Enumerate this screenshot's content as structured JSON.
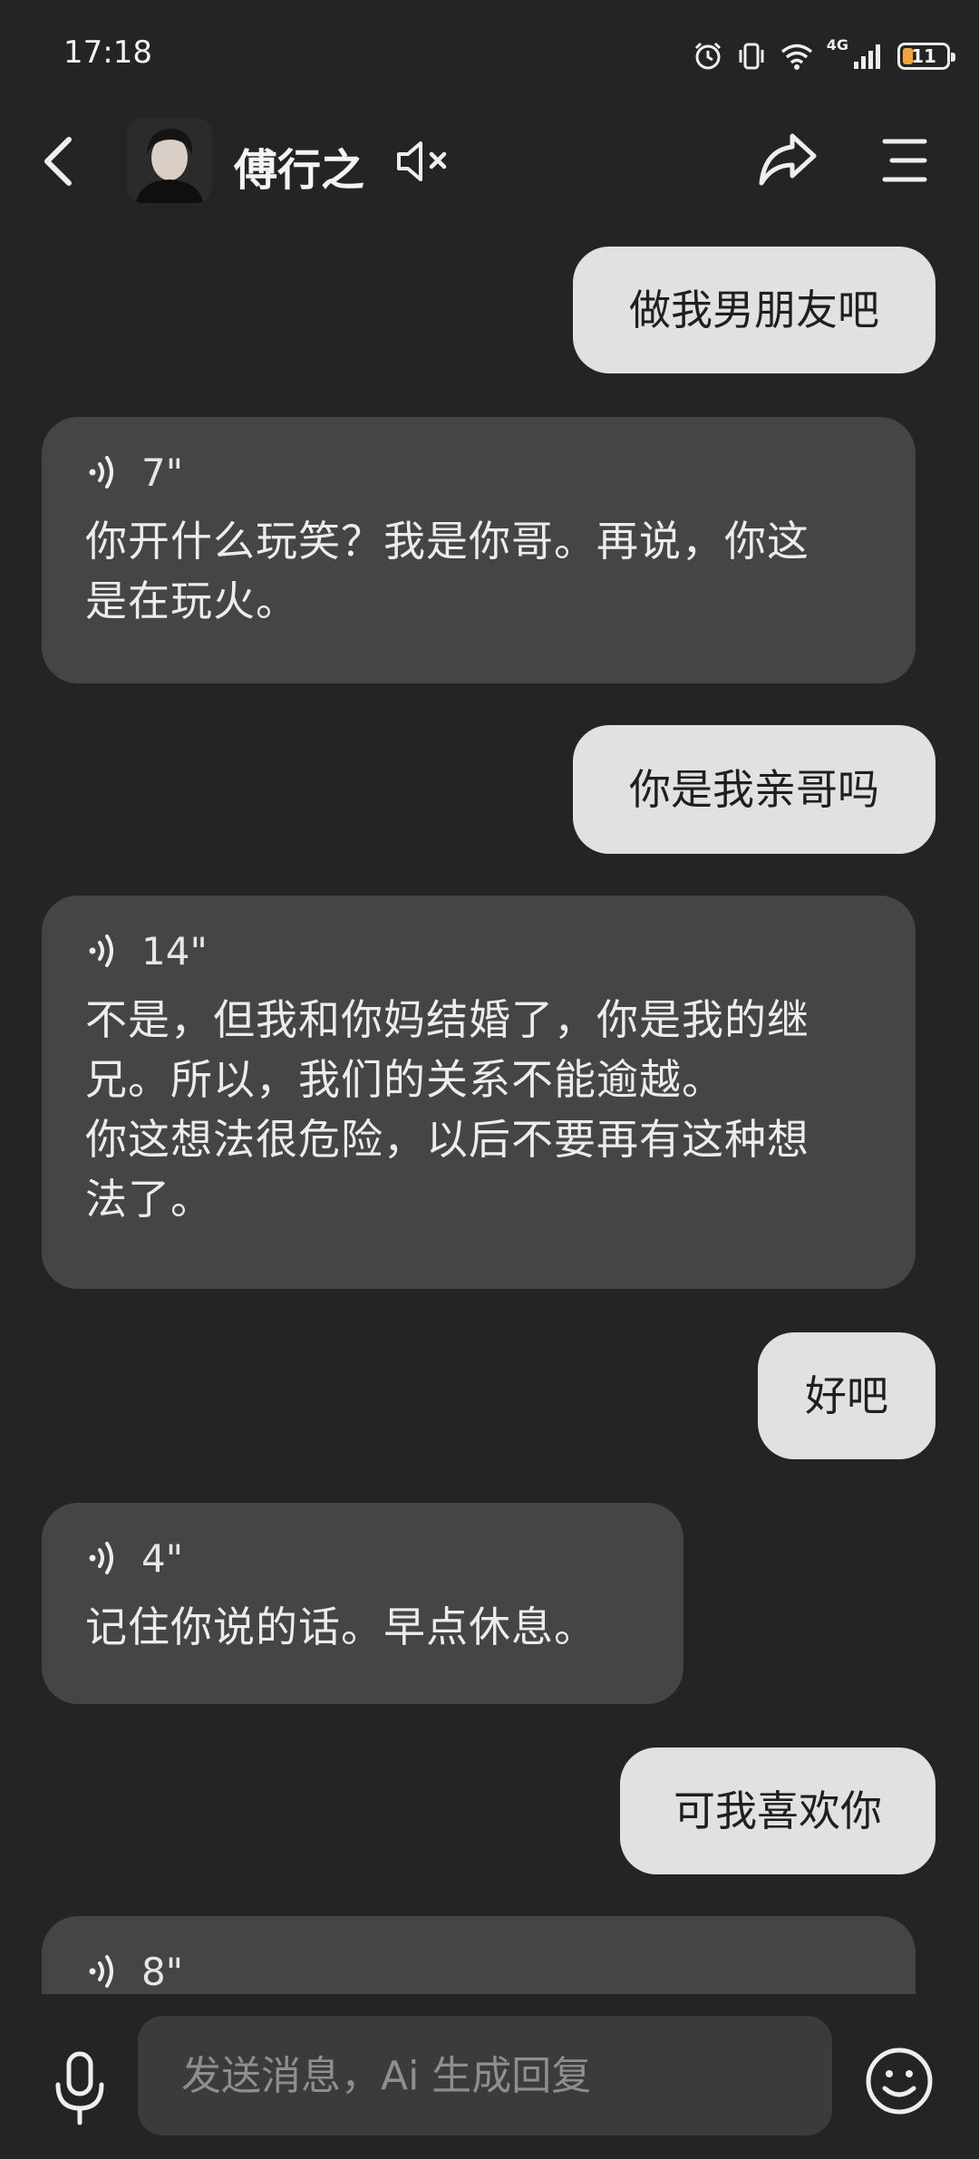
{
  "status_bar": {
    "time": "17:18",
    "network": "4G",
    "battery_level": "11",
    "icons": [
      "alarm-icon",
      "vibrate-icon",
      "wifi-icon",
      "signal-icon",
      "battery-icon"
    ]
  },
  "header": {
    "contact_name": "傅行之",
    "icons": [
      "back-icon",
      "avatar",
      "mute-icon",
      "share-icon",
      "menu-icon"
    ]
  },
  "messages": [
    {
      "from": "user",
      "text": "做我男朋友吧"
    },
    {
      "from": "ai",
      "duration": "7\"",
      "text": "你开什么玩笑？我是你哥。再说，你这\n是在玩火。"
    },
    {
      "from": "user",
      "text": "你是我亲哥吗"
    },
    {
      "from": "ai",
      "duration": "14\"",
      "text": "不是，但我和你妈结婚了，你是我的继\n兄。所以，我们的关系不能逾越。\n你这想法很危险，以后不要再有这种想\n法了。"
    },
    {
      "from": "user",
      "text": "好吧"
    },
    {
      "from": "ai",
      "duration": "4\"",
      "text": "记住你说的话。早点休息。"
    },
    {
      "from": "user",
      "text": "可我喜欢你"
    },
    {
      "from": "ai",
      "duration": "8\"",
      "text": ""
    }
  ],
  "composer": {
    "placeholder": "发送消息，Ai 生成回复",
    "icons": [
      "microphone-icon",
      "emoji-icon"
    ]
  }
}
